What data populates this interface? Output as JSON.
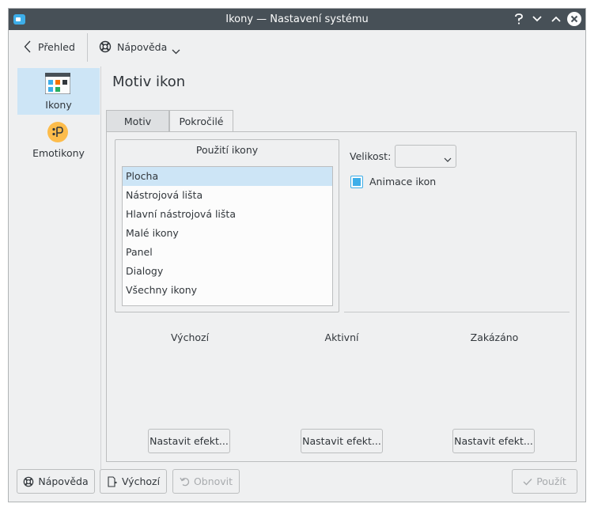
{
  "window": {
    "title": "Ikony  — Nastavení systému"
  },
  "toolbar": {
    "back_label": "Přehled",
    "help_label": "Nápověda"
  },
  "sidebar": {
    "items": [
      {
        "label": "Ikony",
        "icon": "icons-kcm-icon",
        "selected": true
      },
      {
        "label": "Emotikony",
        "icon": "emoticons-icon",
        "selected": false
      }
    ]
  },
  "main": {
    "title": "Motiv ikon",
    "tabs": [
      {
        "label": "Motiv",
        "active": false
      },
      {
        "label": "Pokročilé",
        "active": true
      }
    ],
    "usage_group": {
      "title": "Použití ikony",
      "items": [
        "Plocha",
        "Nástrojová lišta",
        "Hlavní nástrojová lišta",
        "Malé ikony",
        "Panel",
        "Dialogy",
        "Všechny ikony"
      ],
      "selected_index": 0
    },
    "size_label": "Velikost:",
    "size_value": "",
    "animate_label": "Animace ikon",
    "animate_checked": true,
    "states": [
      {
        "label": "Výchozí",
        "button": "Nastavit efekt..."
      },
      {
        "label": "Aktivní",
        "button": "Nastavit efekt..."
      },
      {
        "label": "Zakázáno",
        "button": "Nastavit efekt..."
      }
    ]
  },
  "bottom_bar": {
    "help": "Nápověda",
    "defaults": "Výchozí",
    "reset": "Obnovit",
    "apply": "Použít"
  },
  "colors": {
    "accent": "#3daee9",
    "selection": "#cde5f6",
    "titlebar": "#475057",
    "window_bg": "#eff0f1"
  }
}
